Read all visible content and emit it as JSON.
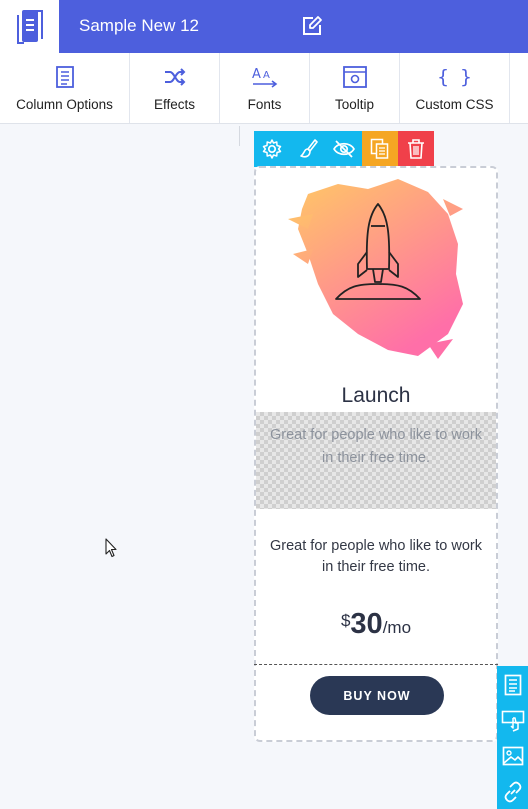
{
  "header": {
    "title": "Sample New 12",
    "logo_icon": "app-logo-icon",
    "edit_icon": "edit-icon",
    "bg_color": "#4d5fdd"
  },
  "toolbar": {
    "items": [
      {
        "label": "Column Options",
        "icon": "column-options-icon"
      },
      {
        "label": "Effects",
        "icon": "shuffle-icon"
      },
      {
        "label": "Fonts",
        "icon": "fonts-icon"
      },
      {
        "label": "Tooltip",
        "icon": "tooltip-icon"
      },
      {
        "label": "Custom CSS",
        "icon": "braces-icon"
      }
    ]
  },
  "column_tools": [
    {
      "icon": "gear-icon",
      "color": "#13b8ee"
    },
    {
      "icon": "brush-icon",
      "color": "#13b8ee"
    },
    {
      "icon": "eye-off-icon",
      "color": "#13b8ee"
    },
    {
      "icon": "duplicate-icon",
      "color": "#f5a623"
    },
    {
      "icon": "trash-icon",
      "color": "#f0404a"
    }
  ],
  "card": {
    "image_icon": "rocket-icon",
    "title": "Launch",
    "placeholder_text": "Great for people who like to work in their free time.",
    "description": "Great for people who like to work in their free time.",
    "price": {
      "currency": "$",
      "amount": "30",
      "period": "/mo"
    },
    "button_label": "BUY NOW",
    "button_color": "#2a3855"
  },
  "side_tools": [
    {
      "icon": "document-icon"
    },
    {
      "icon": "click-icon"
    },
    {
      "icon": "image-icon"
    },
    {
      "icon": "link-icon"
    }
  ],
  "accent_color": "#13b8ee"
}
